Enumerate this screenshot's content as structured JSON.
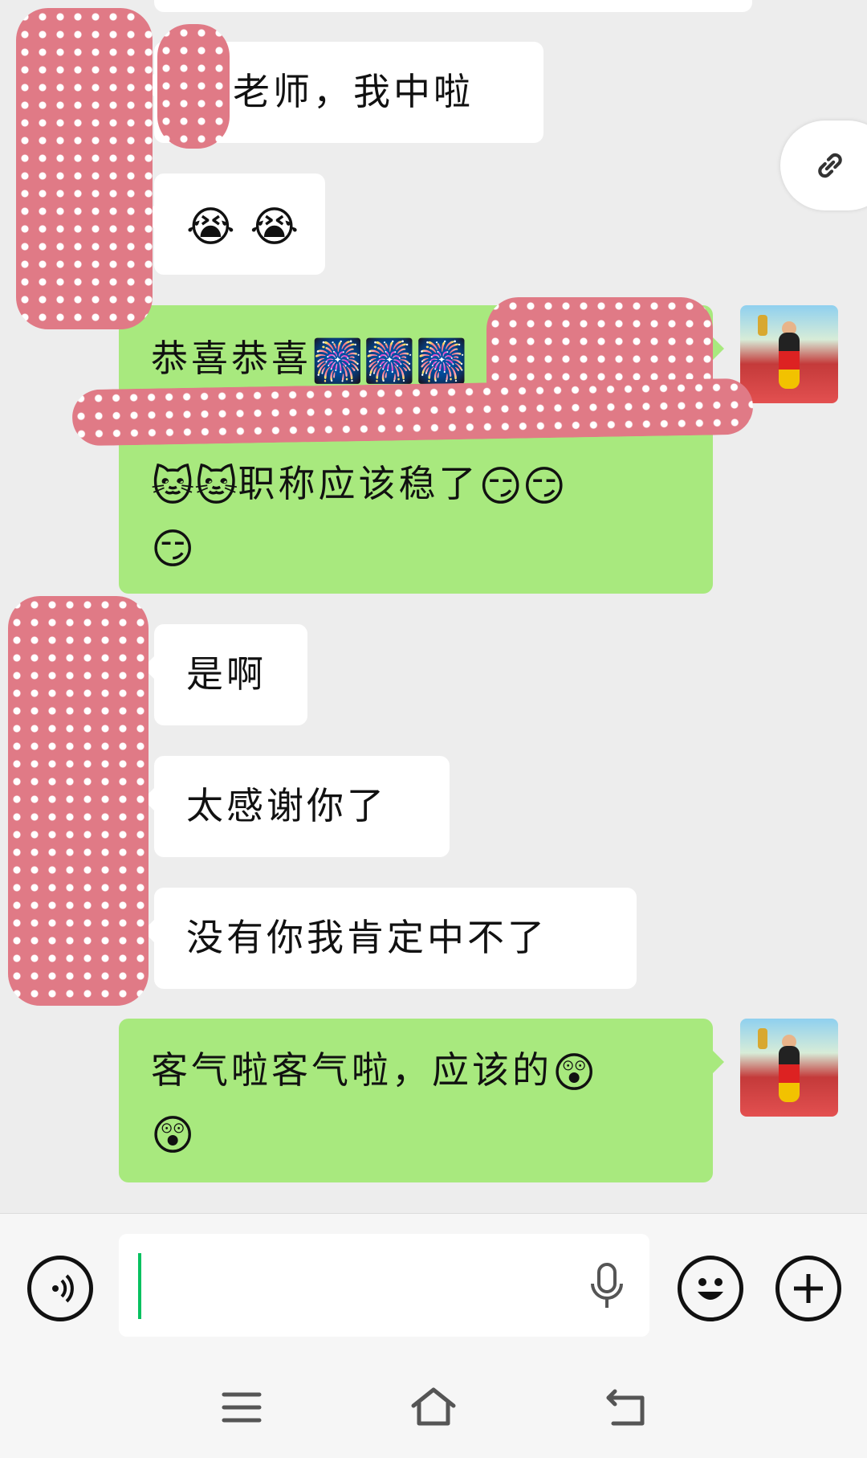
{
  "messages": [
    {
      "side": "left",
      "text": "老师，我中啦",
      "emojis": []
    },
    {
      "side": "left",
      "text": "",
      "emojis": [
        "😭",
        "😭"
      ]
    },
    {
      "side": "right",
      "text_line1": "恭喜恭喜",
      "emojis_line1": [
        "🎆",
        "🎆",
        "🎆"
      ],
      "line3_emojis_before": [
        "🐱",
        "🐱"
      ],
      "line3_text": "职称应该稳了",
      "line3_emojis_after": [
        "😏",
        "😏"
      ],
      "line4_emojis": [
        "😏"
      ]
    },
    {
      "side": "left",
      "text": "是啊"
    },
    {
      "side": "left",
      "text": "太感谢你了"
    },
    {
      "side": "left",
      "text": "没有你我肯定中不了"
    },
    {
      "side": "right",
      "text": "客气啦客气啦，应该的",
      "emojis_after": [
        "😲"
      ],
      "line2_emojis": [
        "😲"
      ]
    }
  ],
  "input": {
    "placeholder": "",
    "value": ""
  },
  "icons": {
    "link": "link-icon",
    "voice": "voice-toggle-icon",
    "mic": "microphone-icon",
    "emoji": "emoji-icon",
    "plus": "plus-icon",
    "menu": "menu-icon",
    "home": "home-icon",
    "back": "back-icon"
  },
  "colors": {
    "chat_bg": "#ededed",
    "sent_bubble": "#a8e97e",
    "received_bubble": "#ffffff",
    "redaction": "#e07a86",
    "cursor": "#07c160"
  }
}
